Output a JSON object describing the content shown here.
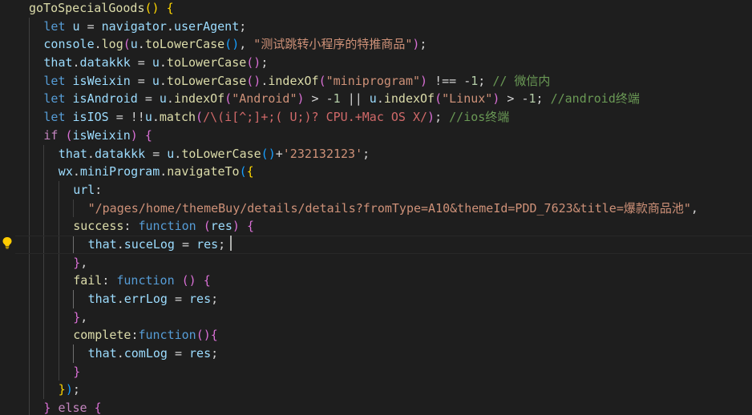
{
  "editor": {
    "lightbulb_icon": "lightbulb-icon",
    "lines": [
      {
        "indent": 0,
        "tokens": [
          [
            "fn",
            "goToSpecialGoods"
          ],
          [
            "br1",
            "()"
          ],
          [
            "pun",
            " "
          ],
          [
            "br1",
            "{"
          ]
        ]
      },
      {
        "indent": 1,
        "tokens": [
          [
            "kw",
            "let"
          ],
          [
            "pun",
            " "
          ],
          [
            "var",
            "u"
          ],
          [
            "pun",
            " = "
          ],
          [
            "var",
            "navigator"
          ],
          [
            "pun",
            "."
          ],
          [
            "var",
            "userAgent"
          ],
          [
            "pun",
            ";"
          ]
        ]
      },
      {
        "indent": 1,
        "tokens": [
          [
            "var",
            "console"
          ],
          [
            "pun",
            "."
          ],
          [
            "fn",
            "log"
          ],
          [
            "br2",
            "("
          ],
          [
            "var",
            "u"
          ],
          [
            "pun",
            "."
          ],
          [
            "fn",
            "toLowerCase"
          ],
          [
            "br3",
            "()"
          ],
          [
            "pun",
            ", "
          ],
          [
            "str",
            "\"测试跳转小程序的特推商品\""
          ],
          [
            "br2",
            ")"
          ],
          [
            "pun",
            ";"
          ]
        ]
      },
      {
        "indent": 1,
        "tokens": [
          [
            "var",
            "that"
          ],
          [
            "pun",
            "."
          ],
          [
            "var",
            "datakkk"
          ],
          [
            "pun",
            " = "
          ],
          [
            "var",
            "u"
          ],
          [
            "pun",
            "."
          ],
          [
            "fn",
            "toLowerCase"
          ],
          [
            "br2",
            "()"
          ],
          [
            "pun",
            ";"
          ]
        ]
      },
      {
        "indent": 1,
        "tokens": [
          [
            "kw",
            "let"
          ],
          [
            "pun",
            " "
          ],
          [
            "var",
            "isWeixin"
          ],
          [
            "pun",
            " = "
          ],
          [
            "var",
            "u"
          ],
          [
            "pun",
            "."
          ],
          [
            "fn",
            "toLowerCase"
          ],
          [
            "br2",
            "()"
          ],
          [
            "pun",
            "."
          ],
          [
            "fn",
            "indexOf"
          ],
          [
            "br2",
            "("
          ],
          [
            "str",
            "\"miniprogram\""
          ],
          [
            "br2",
            ")"
          ],
          [
            "pun",
            " !== -"
          ],
          [
            "num",
            "1"
          ],
          [
            "pun",
            "; "
          ],
          [
            "cm",
            "// 微信内"
          ]
        ]
      },
      {
        "indent": 1,
        "tokens": [
          [
            "kw",
            "let"
          ],
          [
            "pun",
            " "
          ],
          [
            "var",
            "isAndroid"
          ],
          [
            "pun",
            " = "
          ],
          [
            "var",
            "u"
          ],
          [
            "pun",
            "."
          ],
          [
            "fn",
            "indexOf"
          ],
          [
            "br2",
            "("
          ],
          [
            "str",
            "\"Android\""
          ],
          [
            "br2",
            ")"
          ],
          [
            "pun",
            " > -"
          ],
          [
            "num",
            "1"
          ],
          [
            "pun",
            " || "
          ],
          [
            "var",
            "u"
          ],
          [
            "pun",
            "."
          ],
          [
            "fn",
            "indexOf"
          ],
          [
            "br2",
            "("
          ],
          [
            "str",
            "\"Linux\""
          ],
          [
            "br2",
            ")"
          ],
          [
            "pun",
            " > -"
          ],
          [
            "num",
            "1"
          ],
          [
            "pun",
            "; "
          ],
          [
            "cm",
            "//android终端"
          ]
        ]
      },
      {
        "indent": 1,
        "tokens": [
          [
            "kw",
            "let"
          ],
          [
            "pun",
            " "
          ],
          [
            "var",
            "isIOS"
          ],
          [
            "pun",
            " = !!"
          ],
          [
            "var",
            "u"
          ],
          [
            "pun",
            "."
          ],
          [
            "fn",
            "match"
          ],
          [
            "br2",
            "("
          ],
          [
            "re",
            "/\\(i[^;]+;( U;)? CPU.+Mac OS X/"
          ],
          [
            "br2",
            ")"
          ],
          [
            "pun",
            "; "
          ],
          [
            "cm",
            "//ios终端"
          ]
        ]
      },
      {
        "indent": 1,
        "tokens": [
          [
            "ctl",
            "if"
          ],
          [
            "pun",
            " "
          ],
          [
            "br2",
            "("
          ],
          [
            "var",
            "isWeixin"
          ],
          [
            "br2",
            ")"
          ],
          [
            "pun",
            " "
          ],
          [
            "br2",
            "{"
          ]
        ]
      },
      {
        "indent": 2,
        "tokens": [
          [
            "var",
            "that"
          ],
          [
            "pun",
            "."
          ],
          [
            "var",
            "datakkk"
          ],
          [
            "pun",
            " = "
          ],
          [
            "var",
            "u"
          ],
          [
            "pun",
            "."
          ],
          [
            "fn",
            "toLowerCase"
          ],
          [
            "br3",
            "()"
          ],
          [
            "pun",
            "+"
          ],
          [
            "str",
            "'232132123'"
          ],
          [
            "pun",
            ";"
          ]
        ]
      },
      {
        "indent": 2,
        "tokens": [
          [
            "var",
            "wx"
          ],
          [
            "pun",
            "."
          ],
          [
            "var",
            "miniProgram"
          ],
          [
            "pun",
            "."
          ],
          [
            "fn",
            "navigateTo"
          ],
          [
            "br3",
            "("
          ],
          [
            "br1",
            "{"
          ]
        ]
      },
      {
        "indent": 3,
        "tokens": [
          [
            "var",
            "url"
          ],
          [
            "pun",
            ":"
          ]
        ]
      },
      {
        "indent": 4,
        "tokens": [
          [
            "str",
            "\"/pages/home/themeBuy/details/details?fromType=A10&themeId=PDD_7623&title=爆款商品池\""
          ],
          [
            "pun",
            ","
          ]
        ]
      },
      {
        "indent": 3,
        "tokens": [
          [
            "fn",
            "success"
          ],
          [
            "pun",
            ": "
          ],
          [
            "kw",
            "function"
          ],
          [
            "pun",
            " "
          ],
          [
            "br2",
            "("
          ],
          [
            "var",
            "res"
          ],
          [
            "br2",
            ")"
          ],
          [
            "pun",
            " "
          ],
          [
            "br2",
            "{"
          ]
        ]
      },
      {
        "indent": 4,
        "current": true,
        "tokens": [
          [
            "var",
            "that"
          ],
          [
            "pun",
            "."
          ],
          [
            "var",
            "suceLog"
          ],
          [
            "pun",
            " = "
          ],
          [
            "var",
            "res"
          ],
          [
            "pun",
            ";"
          ]
        ]
      },
      {
        "indent": 3,
        "tokens": [
          [
            "br2",
            "}"
          ],
          [
            "pun",
            ","
          ]
        ]
      },
      {
        "indent": 3,
        "tokens": [
          [
            "fn",
            "fail"
          ],
          [
            "pun",
            ": "
          ],
          [
            "kw",
            "function"
          ],
          [
            "pun",
            " "
          ],
          [
            "br2",
            "()"
          ],
          [
            "pun",
            " "
          ],
          [
            "br2",
            "{"
          ]
        ]
      },
      {
        "indent": 4,
        "tokens": [
          [
            "var",
            "that"
          ],
          [
            "pun",
            "."
          ],
          [
            "var",
            "errLog"
          ],
          [
            "pun",
            " = "
          ],
          [
            "var",
            "res"
          ],
          [
            "pun",
            ";"
          ]
        ]
      },
      {
        "indent": 3,
        "tokens": [
          [
            "br2",
            "}"
          ],
          [
            "pun",
            ","
          ]
        ]
      },
      {
        "indent": 3,
        "tokens": [
          [
            "fn",
            "complete"
          ],
          [
            "pun",
            ":"
          ],
          [
            "kw",
            "function"
          ],
          [
            "br2",
            "()"
          ],
          [
            "br2",
            "{"
          ]
        ]
      },
      {
        "indent": 4,
        "tokens": [
          [
            "var",
            "that"
          ],
          [
            "pun",
            "."
          ],
          [
            "var",
            "comLog"
          ],
          [
            "pun",
            " = "
          ],
          [
            "var",
            "res"
          ],
          [
            "pun",
            ";"
          ]
        ]
      },
      {
        "indent": 3,
        "tokens": [
          [
            "br2",
            "}"
          ]
        ]
      },
      {
        "indent": 2,
        "tokens": [
          [
            "br1",
            "}"
          ],
          [
            "br3",
            ")"
          ],
          [
            "pun",
            ";"
          ]
        ]
      },
      {
        "indent": 1,
        "tokens": [
          [
            "br2",
            "}"
          ],
          [
            "pun",
            " "
          ],
          [
            "ctl",
            "else"
          ],
          [
            "pun",
            " "
          ],
          [
            "br2",
            "{"
          ]
        ]
      }
    ]
  }
}
